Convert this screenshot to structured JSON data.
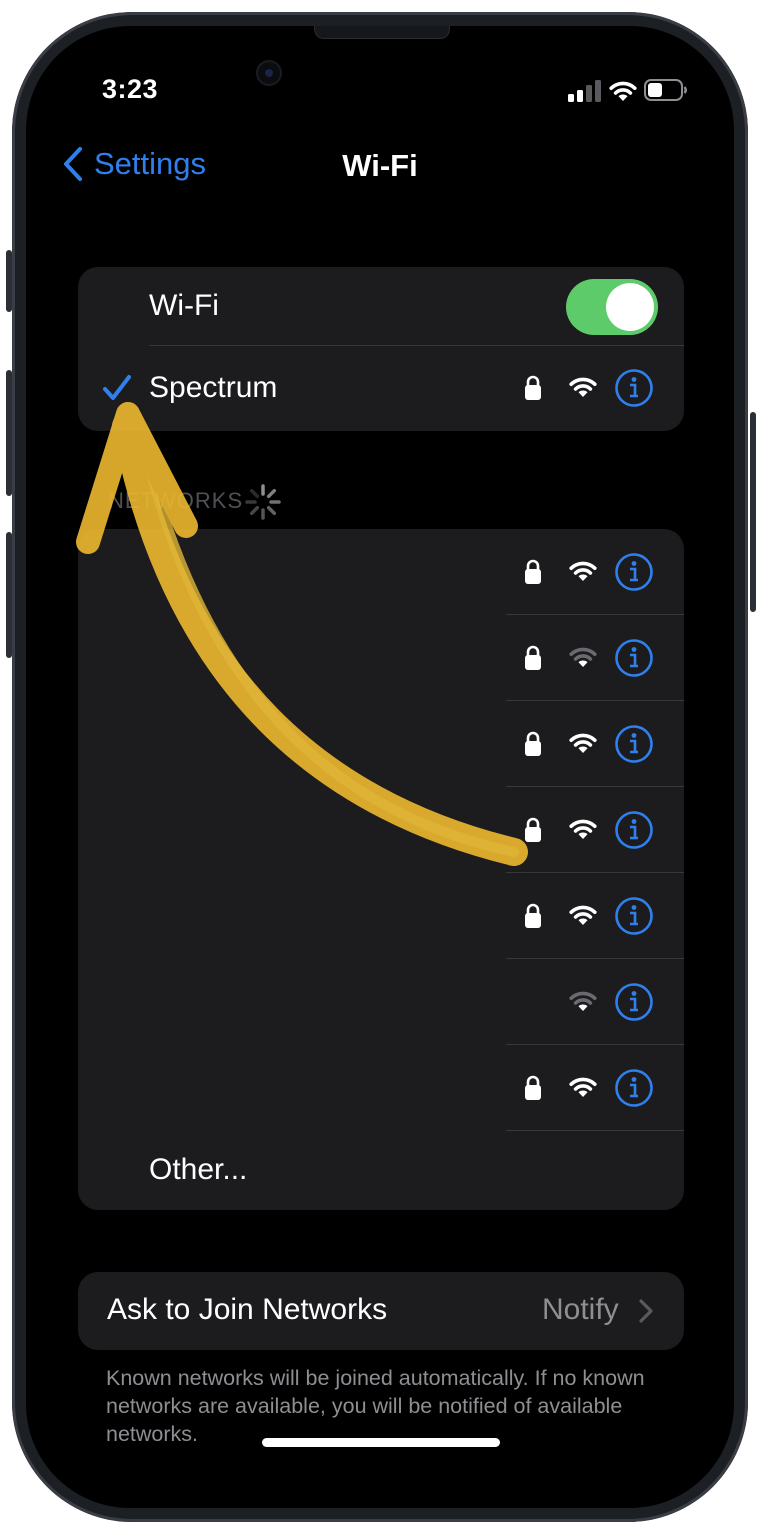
{
  "status_bar": {
    "time": "3:23"
  },
  "nav": {
    "back_label": "Settings",
    "title": "Wi-Fi"
  },
  "wifi_section": {
    "toggle_label": "Wi-Fi",
    "toggle_on": true,
    "connected_network": "Spectrum"
  },
  "networks_section": {
    "header": "NETWORKS",
    "rows": [
      {
        "name": "",
        "locked": true,
        "signal": "full"
      },
      {
        "name": "",
        "locked": true,
        "signal": "weak"
      },
      {
        "name": "",
        "locked": true,
        "signal": "full"
      },
      {
        "name": "",
        "locked": true,
        "signal": "full"
      },
      {
        "name": "",
        "locked": true,
        "signal": "full"
      },
      {
        "name": "",
        "locked": false,
        "signal": "weak"
      },
      {
        "name": "",
        "locked": true,
        "signal": "full"
      }
    ],
    "other_label": "Other..."
  },
  "ask_to_join": {
    "label": "Ask to Join Networks",
    "value": "Notify",
    "footer": "Known networks will be joined automatically. If no known networks are available, you will be notified of available networks."
  },
  "colors": {
    "accent": "#2f80ed",
    "toggle_on": "#5ecb6a",
    "card": "#1c1c1e",
    "annotation_arrow": "#e8b52e"
  },
  "icons": {
    "back": "chevron-left-icon",
    "check": "checkmark-icon",
    "lock": "lock-icon",
    "wifi": "wifi-icon",
    "info": "info-icon",
    "spinner": "spinner-icon",
    "disclosure": "chevron-right-icon"
  }
}
